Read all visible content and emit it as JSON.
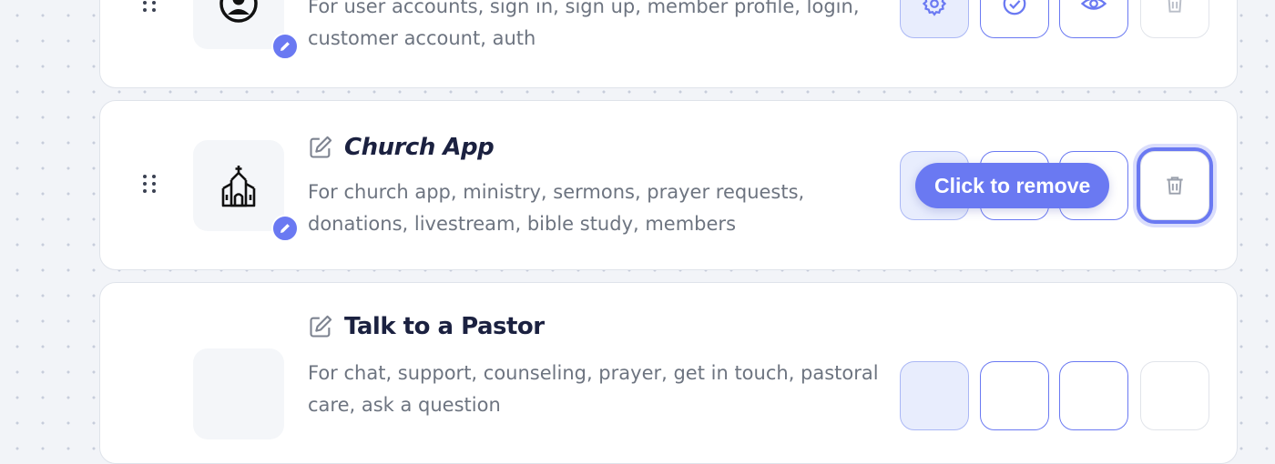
{
  "cards": [
    {
      "title": "",
      "description": "For user accounts, sign in, sign up, member profile, login, customer account, auth",
      "icon": "user-circle-icon"
    },
    {
      "title": "Church App",
      "description": "For church app, ministry, sermons, prayer requests, donations, livestream, bible study, members",
      "icon": "church-icon"
    },
    {
      "title": "Talk to a Pastor",
      "description": "For chat, support, counseling, prayer, get in touch, pastoral care, ask a question",
      "icon": "chat-icon"
    }
  ],
  "tooltip": {
    "text": "Click to remove"
  },
  "colors": {
    "accent": "#6a79f2",
    "title": "#1b2140",
    "body_text": "#6d7480",
    "background": "#f2f4f8"
  }
}
